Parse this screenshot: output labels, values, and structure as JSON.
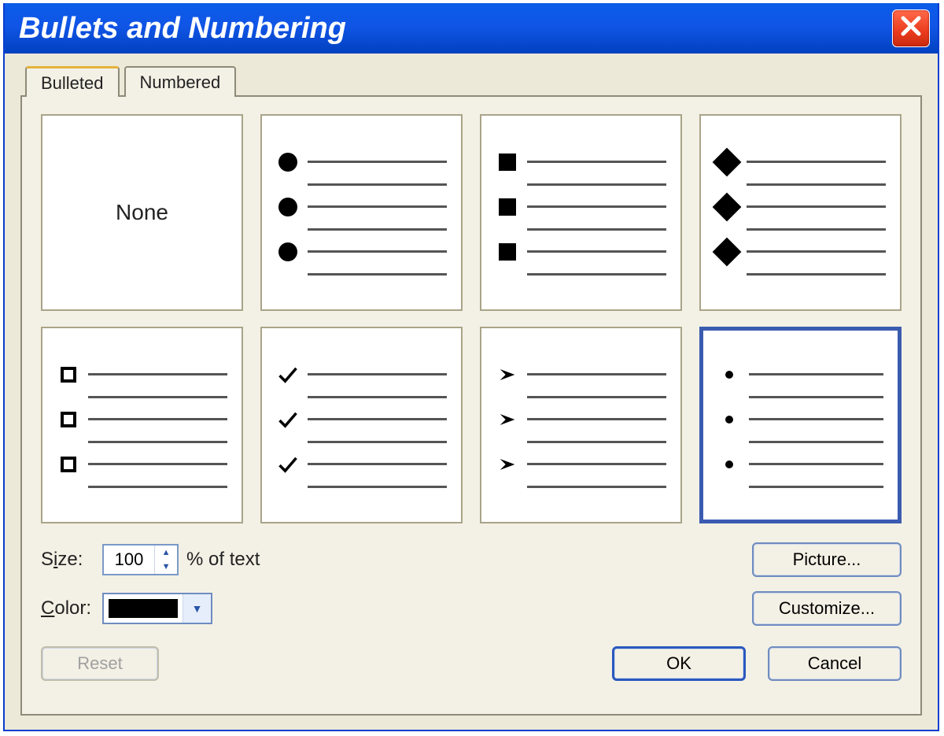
{
  "window": {
    "title": "Bullets and Numbering"
  },
  "tabs": {
    "bulleted": "Bulleted",
    "numbered": "Numbered",
    "active": "bulleted"
  },
  "styles": {
    "none_label": "None",
    "selected_index": 7
  },
  "size": {
    "label_prefix": "S",
    "label_underline": "i",
    "label_suffix": "ze:",
    "value": "100",
    "label_after": "% of text"
  },
  "color": {
    "label_prefix": "",
    "label_underline": "C",
    "label_suffix": "olor:",
    "value": "#000000"
  },
  "buttons": {
    "picture": "Picture...",
    "customize": "Customize...",
    "reset": "Reset",
    "ok": "OK",
    "cancel": "Cancel"
  }
}
